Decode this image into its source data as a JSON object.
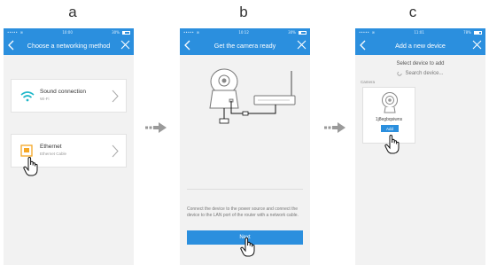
{
  "panels": [
    {
      "letter": "a",
      "status": {
        "carrier": "•••••",
        "time": "10:00",
        "battery": "30%"
      },
      "nav": {
        "title": "Choose a networking method"
      },
      "options": [
        {
          "label": "Sound connection",
          "sub": "Wi-Fi",
          "icon": "wifi-icon"
        },
        {
          "label": "Ethernet",
          "sub": "Ethernet Cable",
          "icon": "ethernet-port-icon"
        }
      ]
    },
    {
      "letter": "b",
      "status": {
        "carrier": "•••••",
        "time": "10:12",
        "battery": "30%"
      },
      "nav": {
        "title": "Get the camera ready"
      },
      "description": "Connect the device to the power source and connect the device to the LAN port of the router with a network cable.",
      "next_label": "Next"
    },
    {
      "letter": "c",
      "status": {
        "carrier": "•••••",
        "time": "11:01",
        "battery": "78%"
      },
      "nav": {
        "title": "Add a new device"
      },
      "select_title": "Select device to add",
      "search_label": "Search device...",
      "category": "Camera",
      "device_name": "1j8egbqsiwns",
      "add_label": "Add"
    }
  ],
  "colors": {
    "accent": "#2b8fde",
    "wifi": "#1fb7c9",
    "ethernet": "#f5a623"
  }
}
